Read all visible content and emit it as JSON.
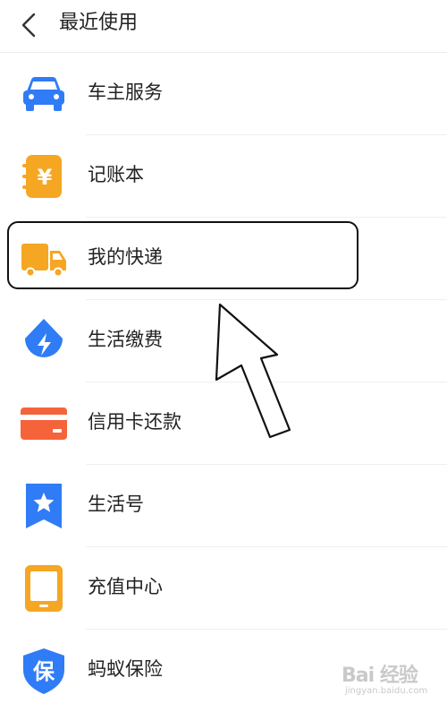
{
  "header": {
    "title": "最近使用"
  },
  "items": [
    {
      "label": "车主服务",
      "icon": "car-icon",
      "color": "#2f7cf6"
    },
    {
      "label": "记账本",
      "icon": "ledger-icon",
      "color": "#f5a623"
    },
    {
      "label": "我的快递",
      "icon": "delivery-truck-icon",
      "color": "#f5a623"
    },
    {
      "label": "生活缴费",
      "icon": "utility-bill-icon",
      "color": "#2f7cf6"
    },
    {
      "label": "信用卡还款",
      "icon": "credit-card-icon",
      "color": "#f5633a"
    },
    {
      "label": "生活号",
      "icon": "star-bookmark-icon",
      "color": "#2f7cf6"
    },
    {
      "label": "充值中心",
      "icon": "tablet-icon",
      "color": "#f5a623"
    },
    {
      "label": "蚂蚁保险",
      "icon": "insurance-shield-icon",
      "color": "#2f7cf6"
    }
  ],
  "icon_glyphs": {
    "ledger": "¥",
    "insurance": "保"
  },
  "watermark": {
    "text": "Bai 经验",
    "sub": "jingyan.baidu.com"
  },
  "colors": {
    "blue": "#2f7cf6",
    "orange": "#f5a623",
    "red": "#f5633a",
    "divider": "#efefef"
  }
}
